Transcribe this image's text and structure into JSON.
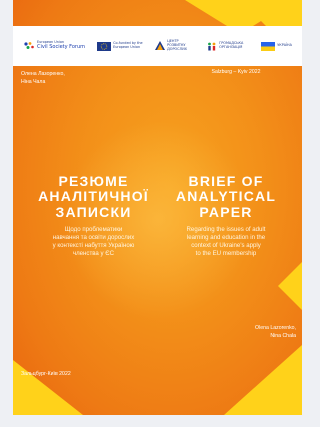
{
  "logos": {
    "csf_small": "European Union",
    "csf_main": "Civil Society Forum",
    "eu_text": "Co-funded by the European Union",
    "center_text": "ЦЕНТР РОЗВИТКУ ДОРОСЛИХ",
    "ngo_text": "ГРОМАДСЬКА ОРГАНІЗАЦІЯ",
    "ua_text": "УКРАЇНА"
  },
  "place_top": "Salzburg – Kyiv 2022",
  "authors_ua": [
    "Олена Лазоренко,",
    "Ніна Чала"
  ],
  "title_ua": [
    "РЕЗЮМЕ",
    "АНАЛІТИЧНОЇ",
    "ЗАПИСКИ"
  ],
  "subtitle_ua": [
    "Щодо проблематики",
    "навчання та освіти дорослих",
    "у контексті набуття Україною",
    "членства у ЄС"
  ],
  "title_en": [
    "BRIEF OF",
    "ANALYTICAL",
    "PAPER"
  ],
  "subtitle_en": [
    "Regarding the issues of adult",
    "learning and education in the",
    "context of Ukraine's apply",
    "to the EU membership"
  ],
  "authors_en": [
    "Olena Lazorenko,",
    "Nina Chala"
  ],
  "place_bottom": "Зальцбург-Київ 2022",
  "colors": {
    "orange": "#f39019",
    "yellow": "#ffd21a",
    "white": "#ffffff"
  }
}
